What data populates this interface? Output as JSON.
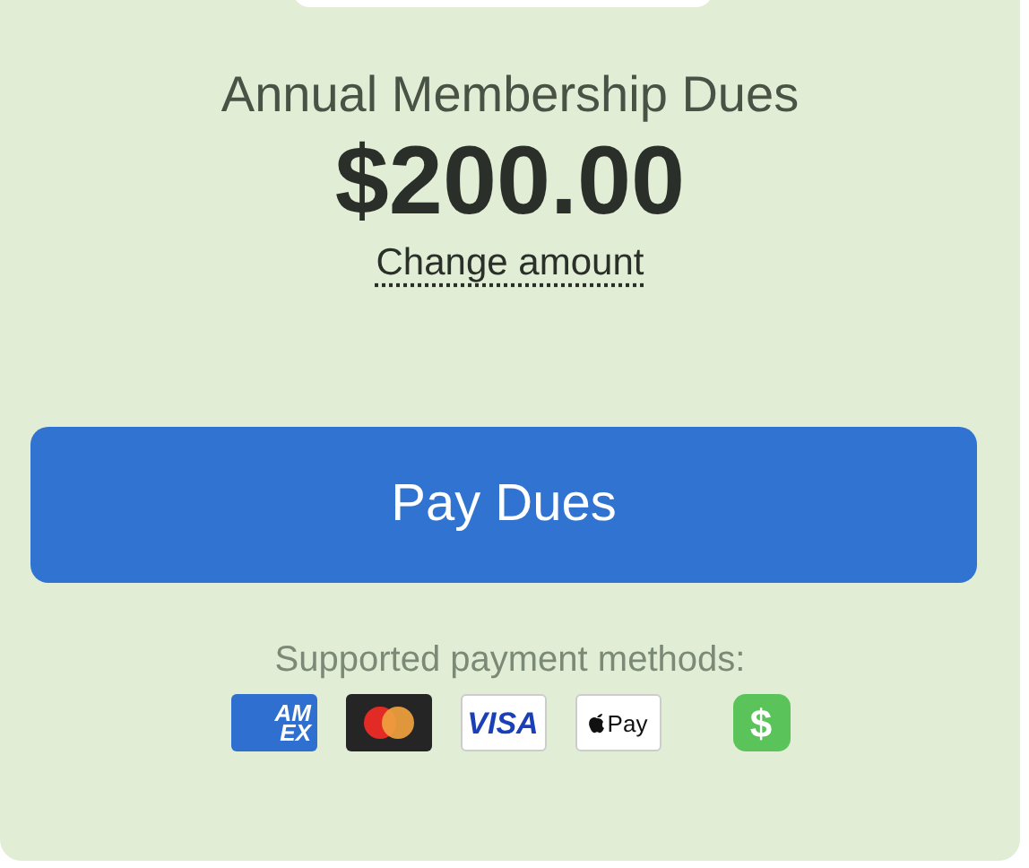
{
  "title": "Annual Membership Dues",
  "amount": "$200.00",
  "change_link": "Change amount",
  "pay_button": "Pay Dues",
  "methods_label": "Supported payment methods:",
  "payment_methods": [
    {
      "kind": "amex",
      "lines": [
        "AM",
        "EX"
      ]
    },
    {
      "kind": "mastercard"
    },
    {
      "kind": "visa",
      "text": "VISA"
    },
    {
      "kind": "applepay",
      "text": "Pay"
    },
    {
      "kind": "cashapp",
      "text": "$"
    }
  ]
}
